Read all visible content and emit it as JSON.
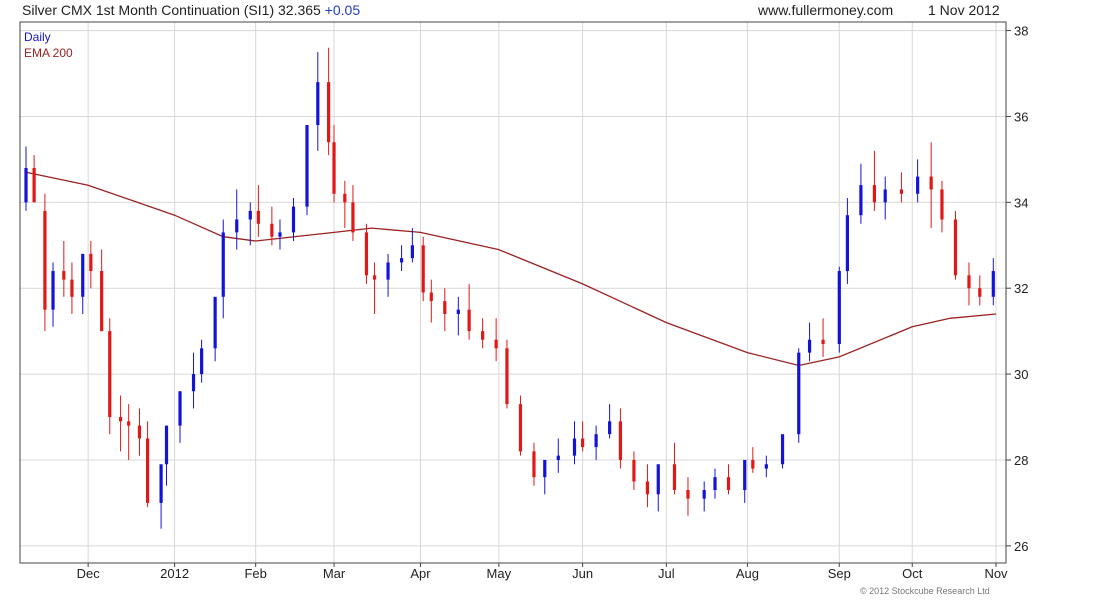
{
  "header": {
    "title": "Silver CMX 1st Month Continuation (SI1) 32.365",
    "change": "+0.05",
    "site": "www.fullermoney.com",
    "date": "1 Nov 2012"
  },
  "footer": {
    "copyright": "© 2012 Stockcube Research Ltd"
  },
  "colors": {
    "up": "#1414d8",
    "down": "#e01818",
    "ema": "#9b2222",
    "grid": "#d8d8d8",
    "frame": "#444444"
  },
  "chart_data": {
    "type": "line",
    "title": "Silver CMX 1st Month Continuation (SI1) 32.365 +0.05",
    "legend": [
      {
        "name": "Daily",
        "color": "#1414d8"
      },
      {
        "name": "EMA 200",
        "color": "#9b2222"
      }
    ],
    "legend_position": "top-left",
    "grid": true,
    "ylim": [
      25.6,
      38.2
    ],
    "y_ticks": [
      26,
      28,
      30,
      32,
      34,
      36,
      38
    ],
    "y_axis_side": "right",
    "x_start": "2011-11-08",
    "x_end": "2012-11-01",
    "x_ticks": [
      {
        "label": "Dec",
        "date": "2011-12-01"
      },
      {
        "label": "2012",
        "date": "2012-01-02"
      },
      {
        "label": "Feb",
        "date": "2012-02-01"
      },
      {
        "label": "Mar",
        "date": "2012-03-01"
      },
      {
        "label": "Apr",
        "date": "2012-04-02"
      },
      {
        "label": "May",
        "date": "2012-05-01"
      },
      {
        "label": "Jun",
        "date": "2012-06-01"
      },
      {
        "label": "Jul",
        "date": "2012-07-02"
      },
      {
        "label": "Aug",
        "date": "2012-08-01"
      },
      {
        "label": "Sep",
        "date": "2012-09-04"
      },
      {
        "label": "Oct",
        "date": "2012-10-01"
      },
      {
        "label": "Nov",
        "date": "2012-11-01"
      }
    ],
    "series": [
      {
        "name": "Daily",
        "style": "candlestick",
        "x": [
          "2011-11-08",
          "2011-11-11",
          "2011-11-15",
          "2011-11-18",
          "2011-11-22",
          "2011-11-25",
          "2011-11-29",
          "2011-12-02",
          "2011-12-06",
          "2011-12-09",
          "2011-12-13",
          "2011-12-16",
          "2011-12-20",
          "2011-12-23",
          "2011-12-28",
          "2011-12-30",
          "2012-01-04",
          "2012-01-09",
          "2012-01-12",
          "2012-01-17",
          "2012-01-20",
          "2012-01-25",
          "2012-01-30",
          "2012-02-02",
          "2012-02-07",
          "2012-02-10",
          "2012-02-15",
          "2012-02-20",
          "2012-02-24",
          "2012-02-28",
          "2012-03-01",
          "2012-03-05",
          "2012-03-08",
          "2012-03-13",
          "2012-03-16",
          "2012-03-21",
          "2012-03-26",
          "2012-03-30",
          "2012-04-03",
          "2012-04-06",
          "2012-04-11",
          "2012-04-16",
          "2012-04-20",
          "2012-04-25",
          "2012-04-30",
          "2012-05-04",
          "2012-05-09",
          "2012-05-14",
          "2012-05-18",
          "2012-05-23",
          "2012-05-29",
          "2012-06-01",
          "2012-06-06",
          "2012-06-11",
          "2012-06-15",
          "2012-06-20",
          "2012-06-25",
          "2012-06-29",
          "2012-07-05",
          "2012-07-10",
          "2012-07-16",
          "2012-07-20",
          "2012-07-25",
          "2012-07-31",
          "2012-08-03",
          "2012-08-08",
          "2012-08-14",
          "2012-08-20",
          "2012-08-24",
          "2012-08-29",
          "2012-09-04",
          "2012-09-07",
          "2012-09-12",
          "2012-09-17",
          "2012-09-21",
          "2012-09-27",
          "2012-10-03",
          "2012-10-08",
          "2012-10-12",
          "2012-10-17",
          "2012-10-22",
          "2012-10-26",
          "2012-10-31"
        ],
        "open": [
          34.0,
          34.8,
          33.8,
          31.5,
          32.4,
          32.2,
          31.8,
          32.8,
          32.4,
          31.0,
          29.0,
          28.9,
          28.8,
          28.5,
          27.0,
          27.9,
          28.8,
          29.6,
          30.0,
          30.6,
          31.8,
          33.3,
          33.6,
          33.8,
          33.5,
          33.2,
          33.3,
          33.9,
          35.8,
          36.8,
          35.4,
          34.2,
          34.0,
          33.3,
          32.3,
          32.2,
          32.6,
          32.7,
          33.0,
          31.9,
          31.7,
          31.4,
          31.5,
          31.0,
          30.8,
          30.6,
          29.3,
          28.2,
          27.6,
          28.0,
          28.1,
          28.5,
          28.3,
          28.6,
          28.9,
          28.0,
          27.5,
          27.2,
          27.9,
          27.3,
          27.1,
          27.3,
          27.6,
          27.3,
          28.0,
          27.8,
          27.9,
          28.6,
          30.5,
          30.8,
          30.7,
          32.4,
          33.7,
          34.4,
          34.0,
          34.3,
          34.2,
          34.6,
          34.3,
          33.6,
          32.3,
          32.0,
          31.8
        ],
        "high": [
          35.3,
          35.1,
          34.2,
          32.6,
          33.1,
          32.6,
          32.2,
          33.1,
          32.9,
          31.3,
          29.5,
          29.3,
          29.2,
          28.9,
          27.5,
          28.5,
          29.6,
          30.5,
          30.8,
          31.6,
          33.6,
          34.3,
          34.0,
          34.4,
          33.9,
          33.6,
          34.1,
          35.2,
          37.5,
          37.6,
          35.8,
          34.5,
          34.4,
          33.5,
          32.6,
          32.8,
          33.0,
          33.4,
          33.2,
          32.2,
          32.0,
          31.8,
          32.1,
          31.3,
          31.3,
          30.8,
          29.5,
          28.4,
          28.0,
          28.5,
          28.9,
          28.9,
          28.8,
          29.3,
          29.2,
          28.2,
          27.9,
          27.7,
          28.4,
          27.6,
          27.5,
          27.8,
          27.9,
          27.6,
          28.3,
          28.1,
          28.3,
          30.6,
          31.2,
          31.3,
          32.5,
          34.1,
          34.9,
          35.2,
          34.6,
          34.7,
          35.0,
          35.4,
          34.5,
          33.8,
          32.6,
          32.3,
          32.7
        ],
        "low": [
          33.8,
          34.2,
          31.0,
          31.1,
          31.8,
          31.4,
          31.4,
          32.0,
          31.0,
          28.6,
          28.2,
          28.0,
          28.1,
          26.9,
          26.4,
          27.4,
          28.4,
          29.2,
          29.8,
          30.3,
          31.3,
          32.9,
          33.0,
          33.2,
          33.0,
          32.9,
          33.1,
          33.7,
          35.2,
          35.1,
          34.0,
          33.4,
          33.1,
          32.1,
          31.4,
          31.8,
          32.4,
          32.6,
          31.7,
          31.2,
          31.0,
          30.9,
          30.8,
          30.6,
          30.3,
          29.2,
          28.1,
          27.4,
          27.2,
          27.7,
          27.9,
          28.2,
          28.0,
          28.5,
          27.8,
          27.3,
          26.9,
          26.8,
          27.2,
          26.7,
          26.8,
          27.1,
          27.2,
          27.0,
          27.7,
          27.6,
          27.8,
          28.4,
          30.3,
          30.4,
          30.5,
          32.1,
          33.5,
          33.8,
          33.6,
          34.0,
          34.0,
          33.4,
          33.3,
          32.2,
          31.6,
          31.6,
          31.6
        ],
        "close": [
          34.8,
          34.0,
          31.5,
          32.4,
          32.2,
          31.8,
          32.8,
          32.4,
          31.0,
          29.0,
          28.9,
          28.8,
          28.5,
          27.0,
          27.9,
          28.8,
          29.6,
          30.0,
          30.6,
          31.8,
          33.3,
          33.6,
          33.8,
          33.5,
          33.2,
          33.3,
          33.9,
          35.8,
          36.8,
          35.4,
          34.2,
          34.0,
          33.3,
          32.3,
          32.2,
          32.6,
          32.7,
          33.0,
          31.9,
          31.7,
          31.4,
          31.5,
          31.0,
          30.8,
          30.6,
          29.3,
          28.2,
          27.6,
          28.0,
          28.1,
          28.5,
          28.3,
          28.6,
          28.9,
          28.0,
          27.5,
          27.2,
          27.9,
          27.3,
          27.1,
          27.3,
          27.6,
          27.3,
          28.0,
          27.8,
          27.9,
          28.6,
          30.5,
          30.8,
          30.7,
          32.4,
          33.7,
          34.4,
          34.0,
          34.3,
          34.2,
          34.6,
          34.3,
          33.6,
          32.3,
          32.0,
          31.8,
          32.4
        ]
      },
      {
        "name": "EMA 200",
        "style": "line",
        "x": [
          "2011-11-08",
          "2011-12-01",
          "2012-01-02",
          "2012-01-20",
          "2012-02-01",
          "2012-03-01",
          "2012-03-15",
          "2012-04-02",
          "2012-05-01",
          "2012-06-01",
          "2012-07-02",
          "2012-08-01",
          "2012-08-20",
          "2012-09-04",
          "2012-10-01",
          "2012-10-15",
          "2012-11-01"
        ],
        "values": [
          34.7,
          34.4,
          33.7,
          33.2,
          33.1,
          33.3,
          33.4,
          33.3,
          32.9,
          32.1,
          31.2,
          30.5,
          30.2,
          30.4,
          31.1,
          31.3,
          31.4
        ]
      }
    ]
  }
}
